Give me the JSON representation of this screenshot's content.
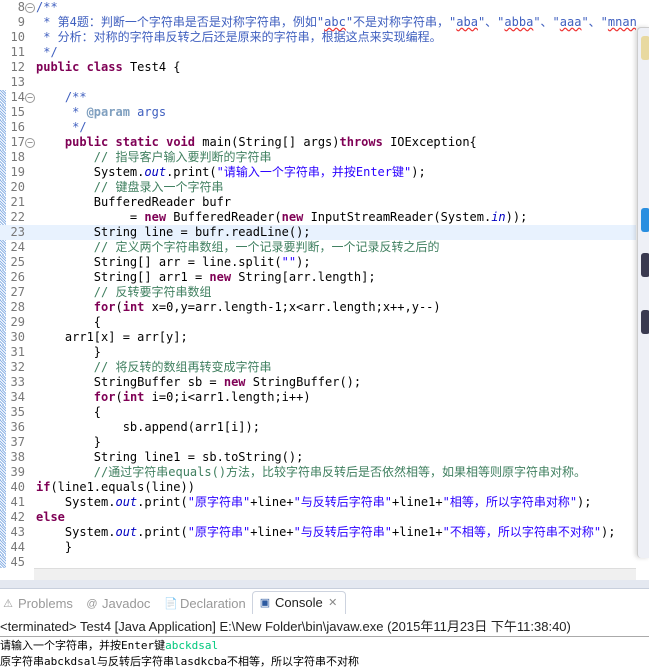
{
  "editor": {
    "highlighted_line": 23,
    "lines": [
      {
        "n": "8",
        "fold": true,
        "t": [
          [
            "jd",
            "/**"
          ]
        ]
      },
      {
        "n": "9",
        "t": [
          [
            "jd",
            " * 第4题：判断一个字符串是否是对称字符串，例如\""
          ],
          [
            "jd sq",
            "abc"
          ],
          [
            "jd",
            "\"不是对称字符串，\""
          ],
          [
            "jd sq",
            "aba"
          ],
          [
            "jd",
            "\"、\""
          ],
          [
            "jd sq",
            "abba"
          ],
          [
            "jd",
            "\"、\""
          ],
          [
            "jd sq",
            "aaa"
          ],
          [
            "jd",
            "\"、\""
          ],
          [
            "jd sq",
            "mnanm"
          ],
          [
            "jd",
            "\"是对称字符串"
          ]
        ]
      },
      {
        "n": "10",
        "t": [
          [
            "jd",
            " * 分析：对称的字符串反转之后还是原来的字符串，根据这点来实现编程。"
          ]
        ]
      },
      {
        "n": "11",
        "t": [
          [
            "jd",
            " */"
          ]
        ]
      },
      {
        "n": "12",
        "t": [
          [
            "kw",
            "public"
          ],
          [
            "tx",
            " "
          ],
          [
            "kw",
            "class"
          ],
          [
            "tx",
            " Test4 {"
          ]
        ]
      },
      {
        "n": "13",
        "t": []
      },
      {
        "n": "14",
        "fold": true,
        "t": [
          [
            "jd",
            "    /**"
          ]
        ]
      },
      {
        "n": "15",
        "t": [
          [
            "jd",
            "     * "
          ],
          [
            "tag",
            "@param"
          ],
          [
            "jd",
            " args"
          ]
        ]
      },
      {
        "n": "16",
        "t": [
          [
            "jd",
            "     */"
          ]
        ]
      },
      {
        "n": "17",
        "fold": true,
        "t": [
          [
            "tx",
            "    "
          ],
          [
            "kw",
            "public"
          ],
          [
            "tx",
            " "
          ],
          [
            "kw",
            "static"
          ],
          [
            "tx",
            " "
          ],
          [
            "kw",
            "void"
          ],
          [
            "tx",
            " main(String[] args)"
          ],
          [
            "kw",
            "throws"
          ],
          [
            "tx",
            " IOException{"
          ]
        ]
      },
      {
        "n": "18",
        "t": [
          [
            "cm",
            "        // 指导客户输入要判断的字符串"
          ]
        ]
      },
      {
        "n": "19",
        "t": [
          [
            "tx",
            "        System."
          ],
          [
            "fld",
            "out"
          ],
          [
            "tx",
            ".print("
          ],
          [
            "str",
            "\"请输入一个字符串，并按Enter键\""
          ],
          [
            "tx",
            ");"
          ]
        ]
      },
      {
        "n": "20",
        "t": [
          [
            "cm",
            "        // 键盘录入一个字符串"
          ]
        ]
      },
      {
        "n": "21",
        "t": [
          [
            "tx",
            "        BufferedReader bufr"
          ]
        ]
      },
      {
        "n": "22",
        "t": [
          [
            "tx",
            "             = "
          ],
          [
            "kw",
            "new"
          ],
          [
            "tx",
            " BufferedReader("
          ],
          [
            "kw",
            "new"
          ],
          [
            "tx",
            " InputStreamReader(System."
          ],
          [
            "fld",
            "in"
          ],
          [
            "tx",
            "));"
          ]
        ]
      },
      {
        "n": "23",
        "t": [
          [
            "tx",
            "        String line = bufr.readLine();"
          ]
        ]
      },
      {
        "n": "24",
        "t": [
          [
            "cm",
            "        // 定义两个字符串数组，一个记录要判断，一个记录反转之后的"
          ]
        ]
      },
      {
        "n": "25",
        "t": [
          [
            "tx",
            "        String[] arr = line.split("
          ],
          [
            "str",
            "\"\""
          ],
          [
            "tx",
            ");"
          ]
        ]
      },
      {
        "n": "26",
        "t": [
          [
            "tx",
            "        String[] arr1 = "
          ],
          [
            "kw",
            "new"
          ],
          [
            "tx",
            " String[arr.length];"
          ]
        ]
      },
      {
        "n": "27",
        "t": [
          [
            "cm",
            "        // 反转要字符串数组"
          ]
        ]
      },
      {
        "n": "28",
        "t": [
          [
            "tx",
            "        "
          ],
          [
            "kw",
            "for"
          ],
          [
            "tx",
            "("
          ],
          [
            "kw",
            "int"
          ],
          [
            "tx",
            " x=0,y=arr.length-1;x<arr.length;x++,y--)"
          ]
        ]
      },
      {
        "n": "29",
        "t": [
          [
            "tx",
            "        {"
          ]
        ]
      },
      {
        "n": "30",
        "t": [
          [
            "tx",
            "    arr1[x] = arr[y];"
          ]
        ]
      },
      {
        "n": "31",
        "t": [
          [
            "tx",
            "        }"
          ]
        ]
      },
      {
        "n": "32",
        "t": [
          [
            "cm",
            "        // 将反转的数组再转变成字符串"
          ]
        ]
      },
      {
        "n": "33",
        "t": [
          [
            "tx",
            "        StringBuffer sb = "
          ],
          [
            "kw",
            "new"
          ],
          [
            "tx",
            " StringBuffer();"
          ]
        ]
      },
      {
        "n": "34",
        "t": [
          [
            "tx",
            "        "
          ],
          [
            "kw",
            "for"
          ],
          [
            "tx",
            "("
          ],
          [
            "kw",
            "int"
          ],
          [
            "tx",
            " i=0;i<arr1.length;i++)"
          ]
        ]
      },
      {
        "n": "35",
        "t": [
          [
            "tx",
            "        {"
          ]
        ]
      },
      {
        "n": "36",
        "t": [
          [
            "tx",
            "            sb.append(arr1[i]);"
          ]
        ]
      },
      {
        "n": "37",
        "t": [
          [
            "tx",
            "        }"
          ]
        ]
      },
      {
        "n": "38",
        "t": [
          [
            "tx",
            "        String line1 = sb.toString();"
          ]
        ]
      },
      {
        "n": "39",
        "t": [
          [
            "cm",
            "        //通过字符串equals()方法，比较字符串反转后是否依然相等，如果相等则原字符串对称。"
          ]
        ]
      },
      {
        "n": "40",
        "t": [
          [
            "kw",
            "if"
          ],
          [
            "tx",
            "(line1.equals(line))"
          ]
        ]
      },
      {
        "n": "41",
        "t": [
          [
            "tx",
            "    System."
          ],
          [
            "fld",
            "out"
          ],
          [
            "tx",
            ".print("
          ],
          [
            "str",
            "\"原字符串\""
          ],
          [
            "tx",
            "+line+"
          ],
          [
            "str",
            "\"与反转后字符串\""
          ],
          [
            "tx",
            "+line1+"
          ],
          [
            "str",
            "\"相等，所以字符串对称\""
          ],
          [
            "tx",
            ");"
          ]
        ]
      },
      {
        "n": "42",
        "t": [
          [
            "kw",
            "else"
          ]
        ]
      },
      {
        "n": "43",
        "t": [
          [
            "tx",
            "    System."
          ],
          [
            "fld",
            "out"
          ],
          [
            "tx",
            ".print("
          ],
          [
            "str",
            "\"原字符串\""
          ],
          [
            "tx",
            "+line+"
          ],
          [
            "str",
            "\"与反转后字符串\""
          ],
          [
            "tx",
            "+line1+"
          ],
          [
            "str",
            "\"不相等，所以字符串不对称\""
          ],
          [
            "tx",
            ");"
          ]
        ]
      },
      {
        "n": "44",
        "t": [
          [
            "tx",
            "    }"
          ]
        ]
      },
      {
        "n": "45",
        "t": []
      }
    ]
  },
  "tabs": [
    {
      "label": "Problems",
      "icon": "problems-icon"
    },
    {
      "label": "Javadoc",
      "icon": "at-icon"
    },
    {
      "label": "Declaration",
      "icon": "declaration-icon"
    },
    {
      "label": "Console",
      "icon": "console-icon",
      "active": true
    }
  ],
  "console": {
    "header": "<terminated> Test4 [Java Application] E:\\New Folder\\bin\\javaw.exe (2015年11月23日 下午11:38:40)",
    "prompt": "请输入一个字符串，并按Enter键",
    "input": "abckdsal",
    "result": "原字符串abckdsal与反转后字符串lasdkcba不相等，所以字符串不对称",
    "input_color": "#00c87d"
  }
}
